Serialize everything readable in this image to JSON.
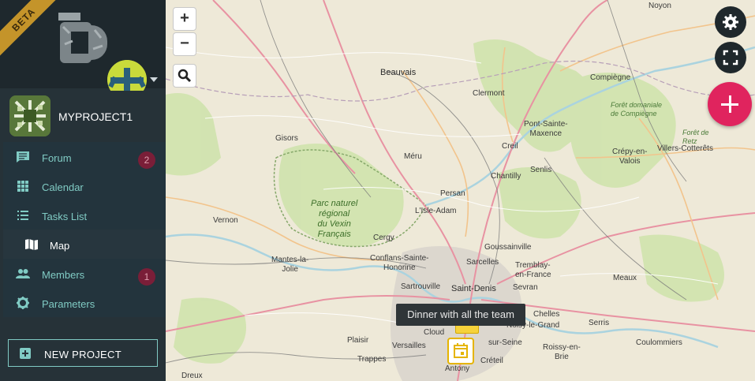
{
  "sidebar": {
    "beta_label": "BETA",
    "project": {
      "name": "MYPROJECT1"
    },
    "menu": [
      {
        "label": "Forum",
        "icon": "forum-icon",
        "badge": "2"
      },
      {
        "label": "Calendar",
        "icon": "calendar-grid-icon"
      },
      {
        "label": "Tasks List",
        "icon": "list-icon"
      },
      {
        "label": "Map",
        "icon": "map-icon",
        "active": true
      },
      {
        "label": "Members",
        "icon": "people-icon",
        "badge": "1"
      },
      {
        "label": "Parameters",
        "icon": "gear-icon"
      }
    ],
    "new_project_label": "NEW PROJECT"
  },
  "map": {
    "zoom_in": "+",
    "zoom_out": "−",
    "tooltip": "Dinner with all the team",
    "places": {
      "noyon": "Noyon",
      "beauvais": "Beauvais",
      "compiegne": "Compiègne",
      "clermont": "Clermont",
      "pont": "Pont-Sainte-\nMaxence",
      "foret_compiegne": "Forêt domaniale\nde Compiègne",
      "foret_retz": "Forêt de\nRetz",
      "gisors": "Gisors",
      "creil": "Creil",
      "crepy": "Crépy-en-\nValois",
      "villers": "Villers-Cotterêts",
      "meru": "Méru",
      "senlis": "Senlis",
      "chantilly": "Chantilly",
      "persan": "Persan",
      "parc": "Parc naturel\nrégional\ndu Vexin\nFrançais",
      "isle_adam": "L'Isle-Adam",
      "vernon": "Vernon",
      "cergy": "Cergy",
      "goussainville": "Goussainville",
      "mantes": "Mantes-la-\nJolie",
      "conflans": "Conflans-Sainte-\nHonorine",
      "sarcelles": "Sarcelles",
      "tremblay": "Tremblay-\nen-France",
      "sevran": "Sevran",
      "meaux": "Meaux",
      "sartrouville": "Sartrouville",
      "saint_denis": "Saint-Denis",
      "chelles": "Chelles",
      "noisy": "Noisy-le-Grand",
      "serris": "Serris",
      "plaisir": "Plaisir",
      "versailles": "Versailles",
      "cloud": "Cloud",
      "sur_seine": "sur-Seine",
      "roissy": "Roissy-en-\nBrie",
      "coulommiers": "Coulommiers",
      "trappes": "Trappes",
      "antony": "Antony",
      "creteil": "Créteil",
      "dreux": "Dreux"
    }
  }
}
